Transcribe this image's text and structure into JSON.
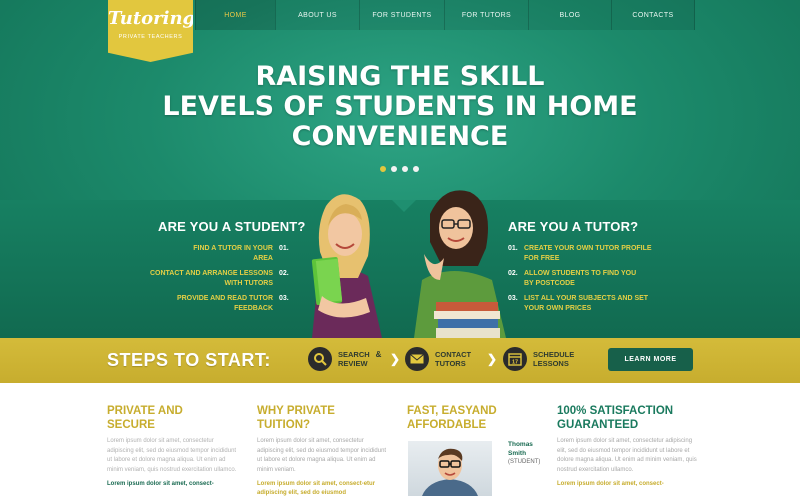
{
  "logo": {
    "title": "Tutoring",
    "subtitle": "PRIVATE TEACHERS"
  },
  "nav": [
    {
      "label": "HOME",
      "active": true
    },
    {
      "label": "ABOUT US",
      "active": false
    },
    {
      "label": "FOR STUDENTS",
      "active": false
    },
    {
      "label": "FOR TUTORS",
      "active": false
    },
    {
      "label": "BLOG",
      "active": false
    },
    {
      "label": "CONTACTS",
      "active": false
    }
  ],
  "hero": {
    "line1": "RAISING THE SKILL",
    "line2": "LEVELS OF STUDENTS IN HOME",
    "line3": "CONVENIENCE",
    "active_slide": 1,
    "slide_count": 4
  },
  "student": {
    "title": "ARE YOU A STUDENT?",
    "steps": [
      {
        "num": "01.",
        "line1": "FIND A TUTOR IN YOUR",
        "line2": "AREA"
      },
      {
        "num": "02.",
        "line1": "CONTACT AND ARRANGE LESSONS",
        "line2": "WITH TUTORS"
      },
      {
        "num": "03.",
        "line1": "PROVIDE AND READ TUTOR",
        "line2": "FEEDBACK"
      }
    ]
  },
  "tutor": {
    "title": "ARE YOU A TUTOR?",
    "steps": [
      {
        "num": "01.",
        "line1": "CREATE YOUR OWN TUTOR PROFILE",
        "line2": "FOR FREE"
      },
      {
        "num": "02.",
        "line1": "ALLOW STUDENTS TO FIND YOU",
        "line2": "BY POSTCODE"
      },
      {
        "num": "03.",
        "line1": "LIST ALL YOUR SUBJECTS AND SET",
        "line2": "YOUR OWN PRICES"
      }
    ]
  },
  "steps_bar": {
    "title": "STEPS TO START:",
    "step1": {
      "line1": "SEARCH",
      "amp": "&",
      "line2": "REVIEW",
      "icon": "search-icon"
    },
    "step2": {
      "line1": "CONTACT",
      "line2": "TUTORS",
      "icon": "envelope-icon"
    },
    "step3": {
      "line1": "SCHEDULE",
      "line2": "LESSONS",
      "icon": "calendar-icon",
      "calendar_day": "17"
    },
    "button": "LEARN MORE"
  },
  "features": {
    "col1": {
      "title1": "PRIVATE AND",
      "title2": "SECURE",
      "body": "Lorem ipsum dolor sit amet, consectetur adipiscing elit, sed do eiusmod tempor incididunt ut labore et dolore magna aliqua. Ut enim ad minim veniam, quis nostrud exercitation ullamco.",
      "link": "Lorem ipsum dolor sit amet, consect-"
    },
    "col2": {
      "title1": "WHY PRIVATE",
      "title2": "TUITION?",
      "body": "Lorem ipsum dolor sit amet, consectetur adipiscing elit, sed do eiusmod tempor incididunt ut labore et dolore magna aliqua. Ut enim ad minim veniam.",
      "link": "Lorem ipsum dolor sit amet, consect-etur adipiscing elit, sed do eiusmod"
    },
    "col3": {
      "title1": "FAST, EASYAND",
      "title2": "AFFORDABLE",
      "name1": "Thomas",
      "name2": "Smith",
      "role": "(STUDENT)"
    },
    "col4": {
      "title1": "100% SATISFACTION",
      "title2": "GUARANTEED",
      "body": "Lorem ipsum dolor sit amet, consectetur adipiscing elit, sed do eiusmod tempor incididunt ut labore et dolore magna aliqua. Ut enim ad minim veniam, quis nostrud exercitation ullamco.",
      "link": "Lorem ipsum dolor sit amet, consect-"
    }
  },
  "colors": {
    "green": "#1c8a6b",
    "gold": "#e2c73e",
    "dark_green": "#17604a"
  }
}
